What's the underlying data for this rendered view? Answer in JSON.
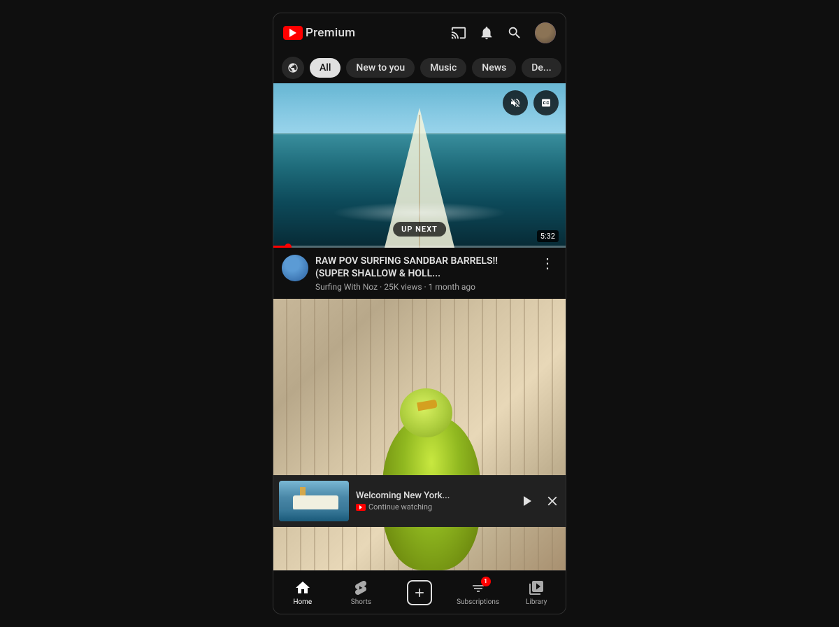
{
  "app": {
    "name": "YouTube Premium",
    "brand": "Premium"
  },
  "header": {
    "logo_alt": "YouTube",
    "brand_label": "Premium",
    "cast_icon": "cast",
    "bell_icon": "notifications",
    "search_icon": "search",
    "avatar_icon": "user-avatar"
  },
  "filters": {
    "explore_icon": "explore",
    "tabs": [
      {
        "id": "all",
        "label": "All",
        "active": true
      },
      {
        "id": "new-to-you",
        "label": "New to you",
        "active": false
      },
      {
        "id": "music",
        "label": "Music",
        "active": false
      },
      {
        "id": "news",
        "label": "News",
        "active": false
      },
      {
        "id": "dev",
        "label": "De...",
        "active": false
      }
    ]
  },
  "current_video": {
    "title": "RAW POV SURFING SANDBAR BARRELS!! (SUPER SHALLOW & HOLL...",
    "channel": "Surfing With Noz",
    "views": "25K views",
    "age": "1 month ago",
    "duration": "5:32",
    "up_next_label": "UP NEXT",
    "progress_percent": 5
  },
  "mini_player": {
    "title": "Welcoming New York...",
    "continue_label": "Continue watching"
  },
  "bottom_nav": {
    "items": [
      {
        "id": "home",
        "label": "Home",
        "icon": "home",
        "active": true
      },
      {
        "id": "shorts",
        "label": "Shorts",
        "icon": "shorts",
        "active": false
      },
      {
        "id": "add",
        "label": "",
        "icon": "add",
        "active": false
      },
      {
        "id": "subscriptions",
        "label": "Subscriptions",
        "icon": "subscriptions",
        "active": false
      },
      {
        "id": "library",
        "label": "Library",
        "icon": "library",
        "active": false
      }
    ],
    "sub_badge_count": "1"
  }
}
